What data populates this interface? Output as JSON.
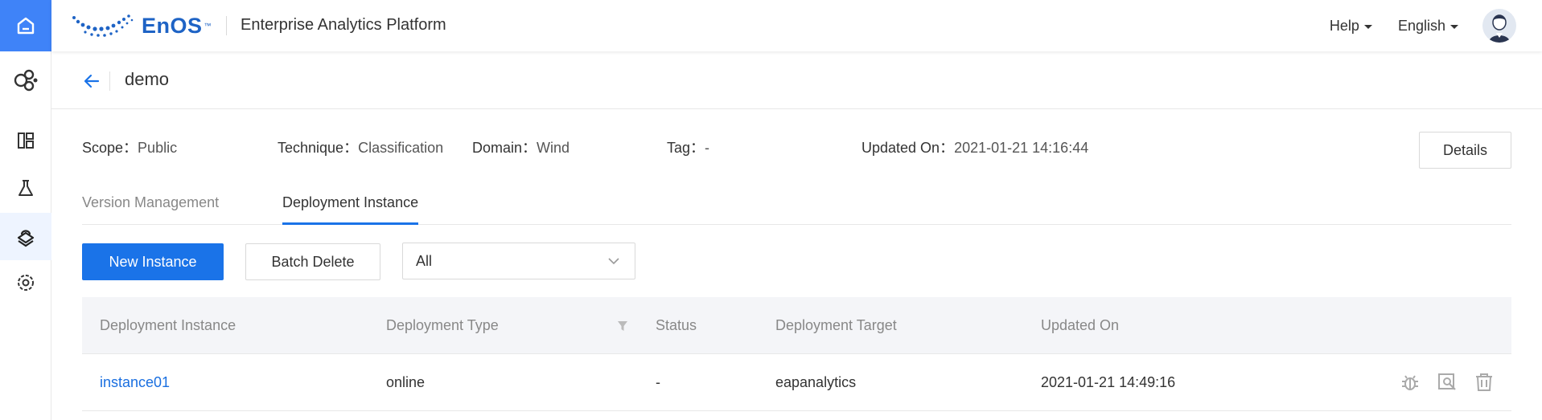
{
  "app": {
    "brand": "EnOS",
    "brand_tm": "™",
    "title": "Enterprise Analytics Platform",
    "accent": "#1a73e8"
  },
  "topbar": {
    "help_label": "Help",
    "language_label": "English"
  },
  "sidebar": {
    "items": [
      {
        "icon": "home-icon",
        "active": true
      },
      {
        "icon": "model-hub-icon"
      },
      {
        "icon": "dashboard-icon"
      },
      {
        "icon": "lab-flask-icon"
      },
      {
        "icon": "model-deploy-icon",
        "active": true
      },
      {
        "icon": "settings-icon"
      }
    ]
  },
  "page": {
    "title": "demo"
  },
  "meta": {
    "scope_key": "Scope：",
    "scope_val": "Public",
    "technique_key": "Technique：",
    "technique_val": "Classification",
    "domain_key": "Domain：",
    "domain_val": "Wind",
    "tag_key": "Tag：",
    "tag_val": "-",
    "updated_key": "Updated On：",
    "updated_val": "2021-01-21 14:16:44",
    "details_label": "Details"
  },
  "tabs": [
    {
      "label": "Version Management",
      "active": false
    },
    {
      "label": "Deployment Instance",
      "active": true
    }
  ],
  "toolbar": {
    "new_label": "New Instance",
    "batch_delete_label": "Batch Delete",
    "filter_value": "All"
  },
  "table": {
    "columns": [
      "Deployment Instance",
      "Deployment Type",
      "Status",
      "Deployment Target",
      "Updated On"
    ],
    "rows": [
      {
        "instance": "instance01",
        "type": "online",
        "status": "-",
        "target": "eapanalytics",
        "updated": "2021-01-21 14:49:16"
      }
    ]
  }
}
